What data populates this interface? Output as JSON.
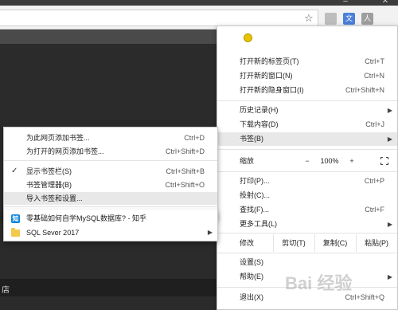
{
  "window": {
    "minimize": "–",
    "close": "✕"
  },
  "toolbar": {
    "star": "☆"
  },
  "extensions": [
    {
      "name": "ext-gray-icon",
      "color": "#bdbdbd",
      "glyph": ""
    },
    {
      "name": "translate-icon",
      "color": "#4a7fd8",
      "glyph": "文"
    },
    {
      "name": "ext-person-icon",
      "color": "#9e9e9e",
      "glyph": "人"
    }
  ],
  "page": {
    "partial_text": "店"
  },
  "menu": {
    "new_tab": {
      "label": "打开新的标签页(T)",
      "shortcut": "Ctrl+T"
    },
    "new_window": {
      "label": "打开新的窗口(N)",
      "shortcut": "Ctrl+N"
    },
    "incognito": {
      "label": "打开新的隐身窗口(I)",
      "shortcut": "Ctrl+Shift+N"
    },
    "history": {
      "label": "历史记录(H)",
      "arrow": "▶"
    },
    "downloads": {
      "label": "下载内容(D)",
      "shortcut": "Ctrl+J"
    },
    "bookmarks": {
      "label": "书签(B)",
      "arrow": "▶"
    },
    "zoom": {
      "label": "缩放",
      "minus": "−",
      "value": "100%",
      "plus": "+"
    },
    "print": {
      "label": "打印(P)...",
      "shortcut": "Ctrl+P"
    },
    "cast": {
      "label": "投射(C)..."
    },
    "find": {
      "label": "查找(F)...",
      "shortcut": "Ctrl+F"
    },
    "more_tools": {
      "label": "更多工具(L)",
      "arrow": "▶"
    },
    "edit": {
      "label": "修改",
      "cut": "剪切(T)",
      "copy": "复制(C)",
      "paste": "粘贴(P)"
    },
    "settings": {
      "label": "设置(S)"
    },
    "help": {
      "label": "帮助(E)",
      "arrow": "▶"
    },
    "exit": {
      "label": "退出(X)",
      "shortcut": "Ctrl+Shift+Q"
    }
  },
  "bookmarks_menu": {
    "bookmark_page": {
      "label": "为此网页添加书签...",
      "shortcut": "Ctrl+D"
    },
    "bookmark_all": {
      "label": "为打开的网页添加书签...",
      "shortcut": "Ctrl+Shift+D"
    },
    "show_bar": {
      "label": "显示书签栏(S)",
      "shortcut": "Ctrl+Shift+B",
      "checked": "✓"
    },
    "manager": {
      "label": "书签管理器(B)",
      "shortcut": "Ctrl+Shift+O"
    },
    "import": {
      "label": "导入书签和设置..."
    },
    "items": [
      {
        "label": "零基础如何自学MySQL数据库? - 知乎",
        "icon": "知"
      },
      {
        "label": "SQL Sever 2017",
        "arrow": "▶"
      }
    ]
  },
  "watermark": {
    "text": "Bai 经验"
  }
}
